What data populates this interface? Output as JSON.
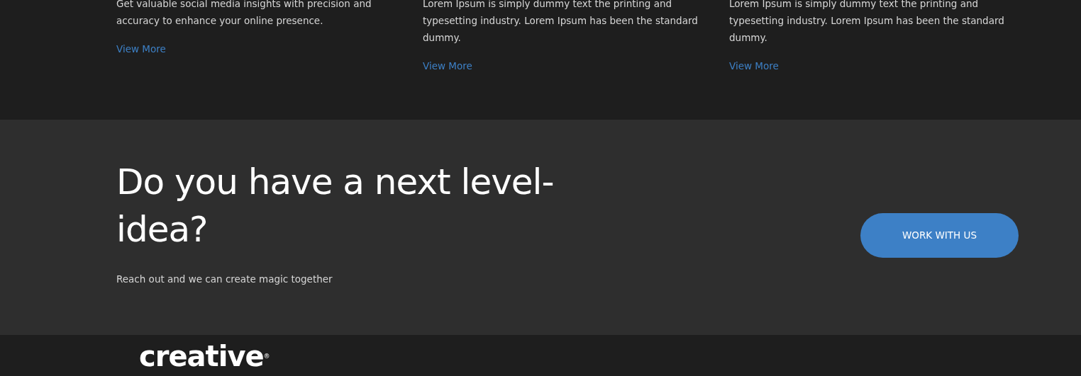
{
  "services": [
    {
      "description": "Get valuable social media insights with precision and accuracy to enhance your online presence.",
      "link": "View More"
    },
    {
      "description": "Lorem Ipsum is simply dummy text the printing and typesetting industry. Lorem Ipsum has been the standard dummy.",
      "link": "View More"
    },
    {
      "description": "Lorem Ipsum is simply dummy text the printing and typesetting industry. Lorem Ipsum has been the standard dummy.",
      "link": "View More"
    }
  ],
  "cta": {
    "heading": "Do you have a next level-idea?",
    "subtitle": "Reach out and we can create magic together",
    "button": "WORK WITH US"
  },
  "footer": {
    "logo": "creative",
    "logo_mark": "®"
  }
}
